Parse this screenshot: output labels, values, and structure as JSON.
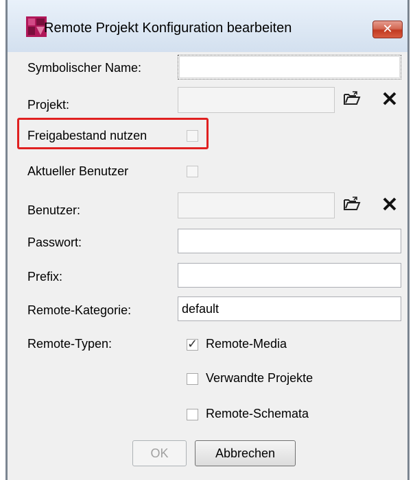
{
  "window": {
    "title": "Remote Projekt Konfiguration bearbeiten",
    "close_label": "✕",
    "icon": "app-logo-icon"
  },
  "form": {
    "symbolic_name": {
      "label": "Symbolischer Name:",
      "value": ""
    },
    "project": {
      "label": "Projekt:",
      "value": ""
    },
    "release_state": {
      "label": "Freigabestand nutzen",
      "checked": false
    },
    "current_user": {
      "label": "Aktueller Benutzer",
      "checked": false
    },
    "user": {
      "label": "Benutzer:",
      "value": ""
    },
    "password": {
      "label": "Passwort:",
      "value": ""
    },
    "prefix": {
      "label": "Prefix:",
      "value": ""
    },
    "remote_category": {
      "label": "Remote-Kategorie:",
      "value": "default"
    },
    "remote_types": {
      "label": "Remote-Typen:",
      "options": [
        {
          "label": "Remote-Media",
          "checked": true
        },
        {
          "label": "Verwandte Projekte",
          "checked": false
        },
        {
          "label": "Remote-Schemata",
          "checked": false
        }
      ]
    }
  },
  "buttons": {
    "ok": "OK",
    "cancel": "Abbrechen"
  },
  "colors": {
    "highlight": "#e02020",
    "close": "#c13a22",
    "dialog_bg": "#f0f0f0"
  }
}
